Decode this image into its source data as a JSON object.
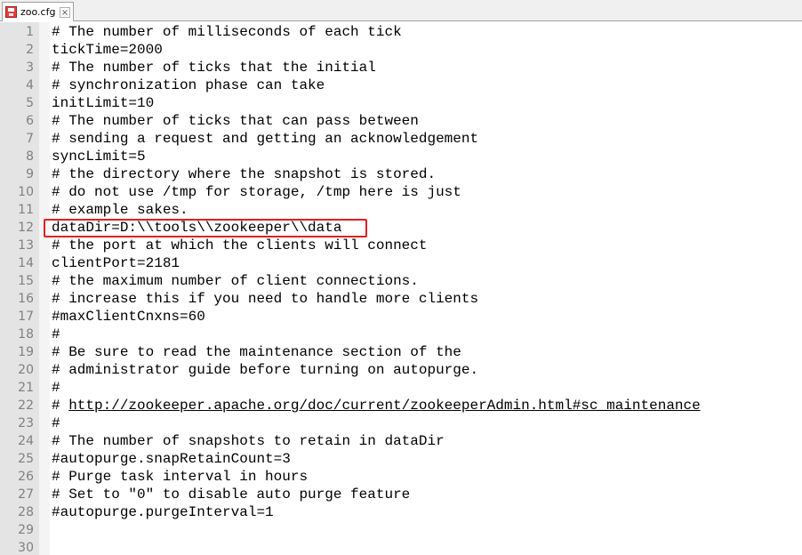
{
  "tab": {
    "label": "zoo.cfg",
    "close_glyph": "×",
    "icon": "save-state-icon",
    "icon_color": "#e04040"
  },
  "highlight": {
    "line_number": "12",
    "color": "#e02020"
  },
  "lines": [
    {
      "n": "1",
      "text": "# The number of milliseconds of each tick"
    },
    {
      "n": "2",
      "text": "tickTime=2000"
    },
    {
      "n": "3",
      "text": "# The number of ticks that the initial"
    },
    {
      "n": "4",
      "text": "# synchronization phase can take"
    },
    {
      "n": "5",
      "text": "initLimit=10"
    },
    {
      "n": "6",
      "text": "# The number of ticks that can pass between"
    },
    {
      "n": "7",
      "text": "# sending a request and getting an acknowledgement"
    },
    {
      "n": "8",
      "text": "syncLimit=5"
    },
    {
      "n": "9",
      "text": "# the directory where the snapshot is stored."
    },
    {
      "n": "10",
      "text": "# do not use /tmp for storage, /tmp here is just"
    },
    {
      "n": "11",
      "text": "# example sakes."
    },
    {
      "n": "12",
      "text": "dataDir=D:\\\\tools\\\\zookeeper\\\\data"
    },
    {
      "n": "13",
      "text": "# the port at which the clients will connect"
    },
    {
      "n": "14",
      "text": "clientPort=2181"
    },
    {
      "n": "15",
      "text": "# the maximum number of client connections."
    },
    {
      "n": "16",
      "text": "# increase this if you need to handle more clients"
    },
    {
      "n": "17",
      "text": "#maxClientCnxns=60"
    },
    {
      "n": "18",
      "text": "#"
    },
    {
      "n": "19",
      "text": "# Be sure to read the maintenance section of the"
    },
    {
      "n": "20",
      "text": "# administrator guide before turning on autopurge."
    },
    {
      "n": "21",
      "text": "#"
    },
    {
      "n": "22",
      "prefix": "# ",
      "link": "http://zookeeper.apache.org/doc/current/zookeeperAdmin.html#sc_maintenance"
    },
    {
      "n": "23",
      "text": "#"
    },
    {
      "n": "24",
      "text": "# The number of snapshots to retain in dataDir"
    },
    {
      "n": "25",
      "text": "#autopurge.snapRetainCount=3"
    },
    {
      "n": "26",
      "text": "# Purge task interval in hours"
    },
    {
      "n": "27",
      "text": "# Set to \"0\" to disable auto purge feature"
    },
    {
      "n": "28",
      "text": "#autopurge.purgeInterval=1"
    },
    {
      "n": "29",
      "text": ""
    },
    {
      "n": "30",
      "text": ""
    }
  ]
}
